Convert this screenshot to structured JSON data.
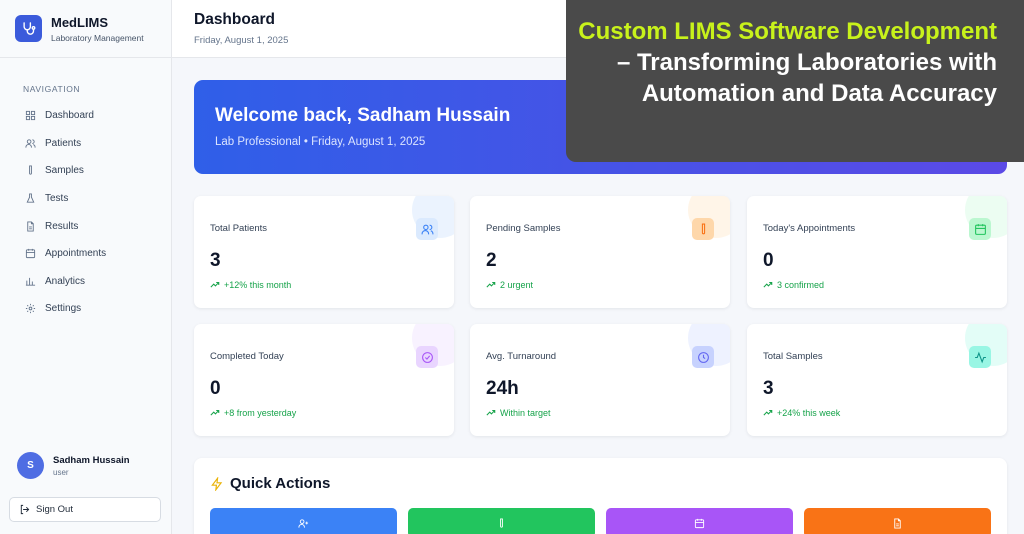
{
  "brand": {
    "name": "MedLIMS",
    "subtitle": "Laboratory Management",
    "accent": "#3b5bdb"
  },
  "sidebar": {
    "heading": "NAVIGATION",
    "items": [
      {
        "label": "Dashboard",
        "icon": "dashboard-icon"
      },
      {
        "label": "Patients",
        "icon": "users-icon"
      },
      {
        "label": "Samples",
        "icon": "test-tube-icon"
      },
      {
        "label": "Tests",
        "icon": "flask-icon"
      },
      {
        "label": "Results",
        "icon": "file-icon"
      },
      {
        "label": "Appointments",
        "icon": "calendar-icon"
      },
      {
        "label": "Analytics",
        "icon": "bar-chart-icon"
      },
      {
        "label": "Settings",
        "icon": "gear-icon"
      }
    ],
    "user": {
      "initial": "S",
      "name": "Sadham Hussain",
      "role": "user"
    },
    "signout_label": "Sign Out"
  },
  "header": {
    "title": "Dashboard",
    "date": "Friday, August 1, 2025"
  },
  "welcome": {
    "title": "Welcome back, Sadham Hussain",
    "subtitle": "Lab Professional • Friday, August 1, 2025"
  },
  "stats": [
    {
      "label": "Total Patients",
      "value": "3",
      "trend": "+12% this month",
      "icon": "users-icon",
      "color": "#3b82f6"
    },
    {
      "label": "Pending Samples",
      "value": "2",
      "trend": "2 urgent",
      "icon": "test-tube-icon",
      "color": "#f97316"
    },
    {
      "label": "Today's Appointments",
      "value": "0",
      "trend": "3 confirmed",
      "icon": "calendar-icon",
      "color": "#22c55e"
    },
    {
      "label": "Completed Today",
      "value": "0",
      "trend": "+8 from yesterday",
      "icon": "check-circle-icon",
      "color": "#a855f7"
    },
    {
      "label": "Avg. Turnaround",
      "value": "24h",
      "trend": "Within target",
      "icon": "clock-icon",
      "color": "#6366f1"
    },
    {
      "label": "Total Samples",
      "value": "3",
      "trend": "+24% this week",
      "icon": "activity-icon",
      "color": "#14b8a6"
    }
  ],
  "quick_actions": {
    "title": "Quick Actions",
    "buttons": [
      {
        "icon": "user-plus-icon",
        "color": "#3b82f6"
      },
      {
        "icon": "test-tube-icon",
        "color": "#22c55e"
      },
      {
        "icon": "calendar-icon",
        "color": "#a855f7"
      },
      {
        "icon": "file-icon",
        "color": "#f97316"
      }
    ]
  },
  "overlay": {
    "highlight": "Custom LIMS Software Development",
    "rest": " – Transforming Laboratories with Automation and Data Accuracy",
    "highlight_color": "#c8f21b"
  }
}
